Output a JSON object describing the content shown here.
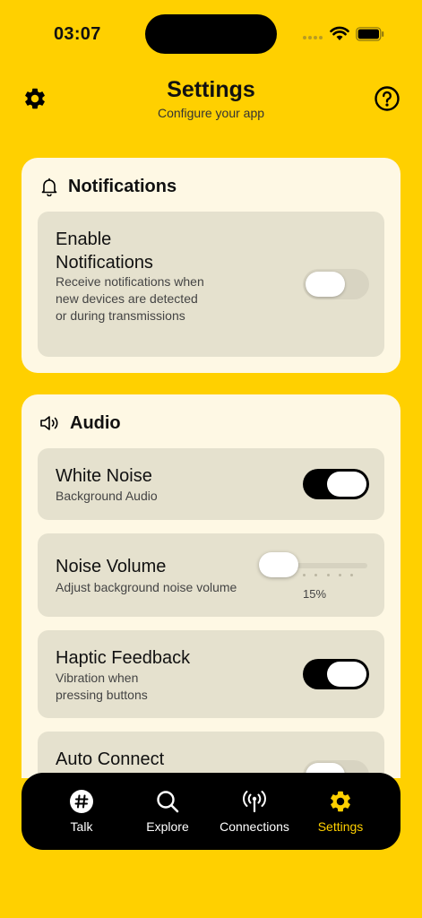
{
  "status_bar": {
    "time": "03:07"
  },
  "header": {
    "title": "Settings",
    "subtitle": "Configure your app",
    "left_icon": "gear-icon",
    "right_icon": "help-circle-icon"
  },
  "notifications": {
    "heading": "Notifications",
    "icon": "bell-icon",
    "enable": {
      "title": "Enable Notifications",
      "description": "Receive notifications when new devices are detected or during transmissions",
      "enabled": false
    }
  },
  "audio": {
    "heading": "Audio",
    "icon": "speaker-icon",
    "white_noise": {
      "title": "White Noise",
      "description": "Background Audio",
      "enabled": true
    },
    "noise_volume": {
      "title": "Noise Volume",
      "description": "Adjust background noise volume",
      "value_label": "15%",
      "value": 0.15
    },
    "haptic": {
      "title": "Haptic Feedback",
      "description": "Vibration when pressing buttons",
      "enabled": true
    },
    "auto_connect": {
      "title": "Auto Connect"
    }
  },
  "tabs": [
    {
      "label": "Talk",
      "icon": "hashtag-icon",
      "active": false
    },
    {
      "label": "Explore",
      "icon": "search-icon",
      "active": false
    },
    {
      "label": "Connections",
      "icon": "antenna-icon",
      "active": false
    },
    {
      "label": "Settings",
      "icon": "gear-icon",
      "active": true
    }
  ],
  "colors": {
    "background": "#FFD000",
    "card": "#FEF8E4",
    "row": "#E5E1CE",
    "accent": "#FFD000",
    "tabbar": "#000000"
  }
}
